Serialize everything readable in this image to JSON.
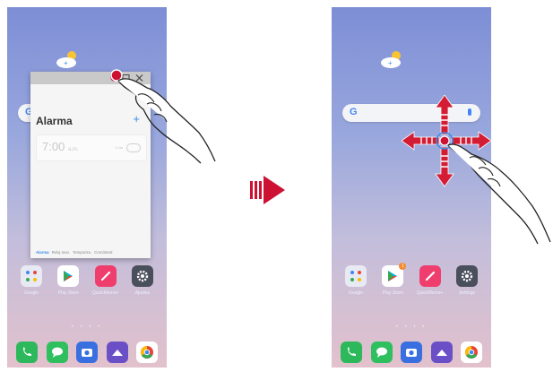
{
  "left_screen": {
    "popup": {
      "title": "Alarma",
      "add_label": "+",
      "alarm_time": "7:00",
      "alarm_ampm": "a.m.",
      "alarm_days": "1 día",
      "tabs": [
        "Alarma",
        "Reloj mun.",
        "Temporiza.",
        "Cronómetr."
      ],
      "active_tab_index": 0
    },
    "apps": [
      {
        "label": "Google",
        "icon": "google-folder-icon"
      },
      {
        "label": "Play Store",
        "icon": "play-store-icon"
      },
      {
        "label": "QuickMemo+",
        "icon": "quickmemo-icon"
      },
      {
        "label": "Ajustes",
        "icon": "settings-icon"
      }
    ]
  },
  "right_screen": {
    "apps": [
      {
        "label": "Google",
        "icon": "google-folder-icon",
        "badge": "1"
      },
      {
        "label": "Play Store",
        "icon": "play-store-icon"
      },
      {
        "label": "QuickMemo+",
        "icon": "quickmemo-icon"
      },
      {
        "label": "Settings",
        "icon": "settings-icon"
      }
    ]
  },
  "page_dots": "• • • •",
  "dock_icons": [
    "phone-icon",
    "messages-icon",
    "camera-icon",
    "gallery-icon",
    "chrome-icon"
  ],
  "colors": {
    "accent_red": "#cc1133",
    "accent_blue": "#3c8be5",
    "arrow_red": "#d41c34"
  }
}
